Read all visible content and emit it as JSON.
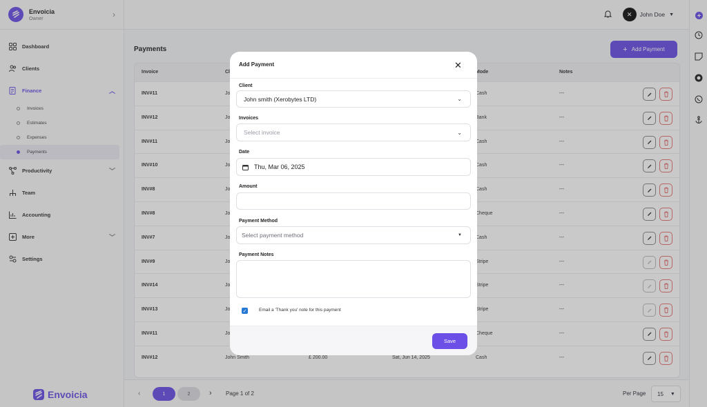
{
  "brand": {
    "name": "Envoicia",
    "role": "Owner",
    "footer_name": "Envoicia"
  },
  "sidebar": {
    "items": [
      {
        "label": "Dashboard"
      },
      {
        "label": "Clients"
      },
      {
        "label": "Finance"
      },
      {
        "label": "Productivity"
      },
      {
        "label": "Team"
      },
      {
        "label": "Accounting"
      },
      {
        "label": "More"
      },
      {
        "label": "Settings"
      }
    ],
    "finance_sub": [
      {
        "label": "Invoices"
      },
      {
        "label": "Estimates"
      },
      {
        "label": "Expenses"
      },
      {
        "label": "Payments"
      }
    ]
  },
  "topbar": {
    "user_name": "John Doe"
  },
  "page": {
    "title": "Payments",
    "add_label": "Add Payment"
  },
  "table": {
    "headers": [
      "Invoice",
      "Cl",
      "",
      "",
      "Mode",
      "Notes"
    ],
    "rows": [
      {
        "invoice": "INV#11",
        "client": "Jo",
        "amount": "",
        "date": "",
        "mode": "Cash",
        "notes": "---",
        "edit_enabled": true
      },
      {
        "invoice": "INV#12",
        "client": "Jo",
        "amount": "",
        "date": "",
        "mode": "Bank",
        "notes": "---",
        "edit_enabled": true
      },
      {
        "invoice": "INV#11",
        "client": "Jo",
        "amount": "",
        "date": "",
        "mode": "Cash",
        "notes": "---",
        "edit_enabled": true
      },
      {
        "invoice": "INV#10",
        "client": "Jo",
        "amount": "",
        "date": "",
        "mode": "Cash",
        "notes": "---",
        "edit_enabled": true
      },
      {
        "invoice": "INV#8",
        "client": "Jo",
        "amount": "",
        "date": "",
        "mode": "Cash",
        "notes": "---",
        "edit_enabled": true
      },
      {
        "invoice": "INV#8",
        "client": "Jo",
        "amount": "",
        "date": "",
        "mode": "Cheque",
        "notes": "---",
        "edit_enabled": true
      },
      {
        "invoice": "INV#7",
        "client": "Jo",
        "amount": "",
        "date": "",
        "mode": "Cash",
        "notes": "---",
        "edit_enabled": true
      },
      {
        "invoice": "INV#9",
        "client": "Jo",
        "amount": "",
        "date": "",
        "mode": "Stripe",
        "notes": "---",
        "edit_enabled": false
      },
      {
        "invoice": "INV#14",
        "client": "Jo",
        "amount": "",
        "date": "",
        "mode": "Stripe",
        "notes": "---",
        "edit_enabled": false
      },
      {
        "invoice": "INV#13",
        "client": "Jo",
        "amount": "",
        "date": "",
        "mode": "Stripe",
        "notes": "---",
        "edit_enabled": false
      },
      {
        "invoice": "INV#11",
        "client": "Jo",
        "amount": "",
        "date": "",
        "mode": "Cheque",
        "notes": "---",
        "edit_enabled": true
      },
      {
        "invoice": "INV#12",
        "client": "John Smith",
        "amount": "£ 200.00",
        "date": "Sat, Jun 14, 2025",
        "mode": "Cash",
        "notes": "---",
        "edit_enabled": true
      }
    ]
  },
  "pagination": {
    "pages": [
      "1",
      "2"
    ],
    "info": "Page 1 of 2",
    "per_page_label": "Per Page",
    "per_page": "15"
  },
  "modal": {
    "title": "Add Payment",
    "client_label": "Client",
    "client_value": "John smith (Xerobytes LTD)",
    "invoices_label": "Invoices",
    "invoices_placeholder": "Select invoice",
    "date_label": "Date",
    "date_value": "Thu, Mar 06, 2025",
    "amount_label": "Amount",
    "amount_value": "",
    "method_label": "Payment Method",
    "method_placeholder": "Select payment method",
    "notes_label": "Payment Notes",
    "notes_value": "",
    "thankyou_label": "Email a 'Thank you' note for this payment",
    "thankyou_checked": true,
    "save_label": "Save"
  },
  "colors": {
    "accent": "#6b4fe6",
    "delete": "#e57373",
    "checkbox": "#2a78d6"
  }
}
